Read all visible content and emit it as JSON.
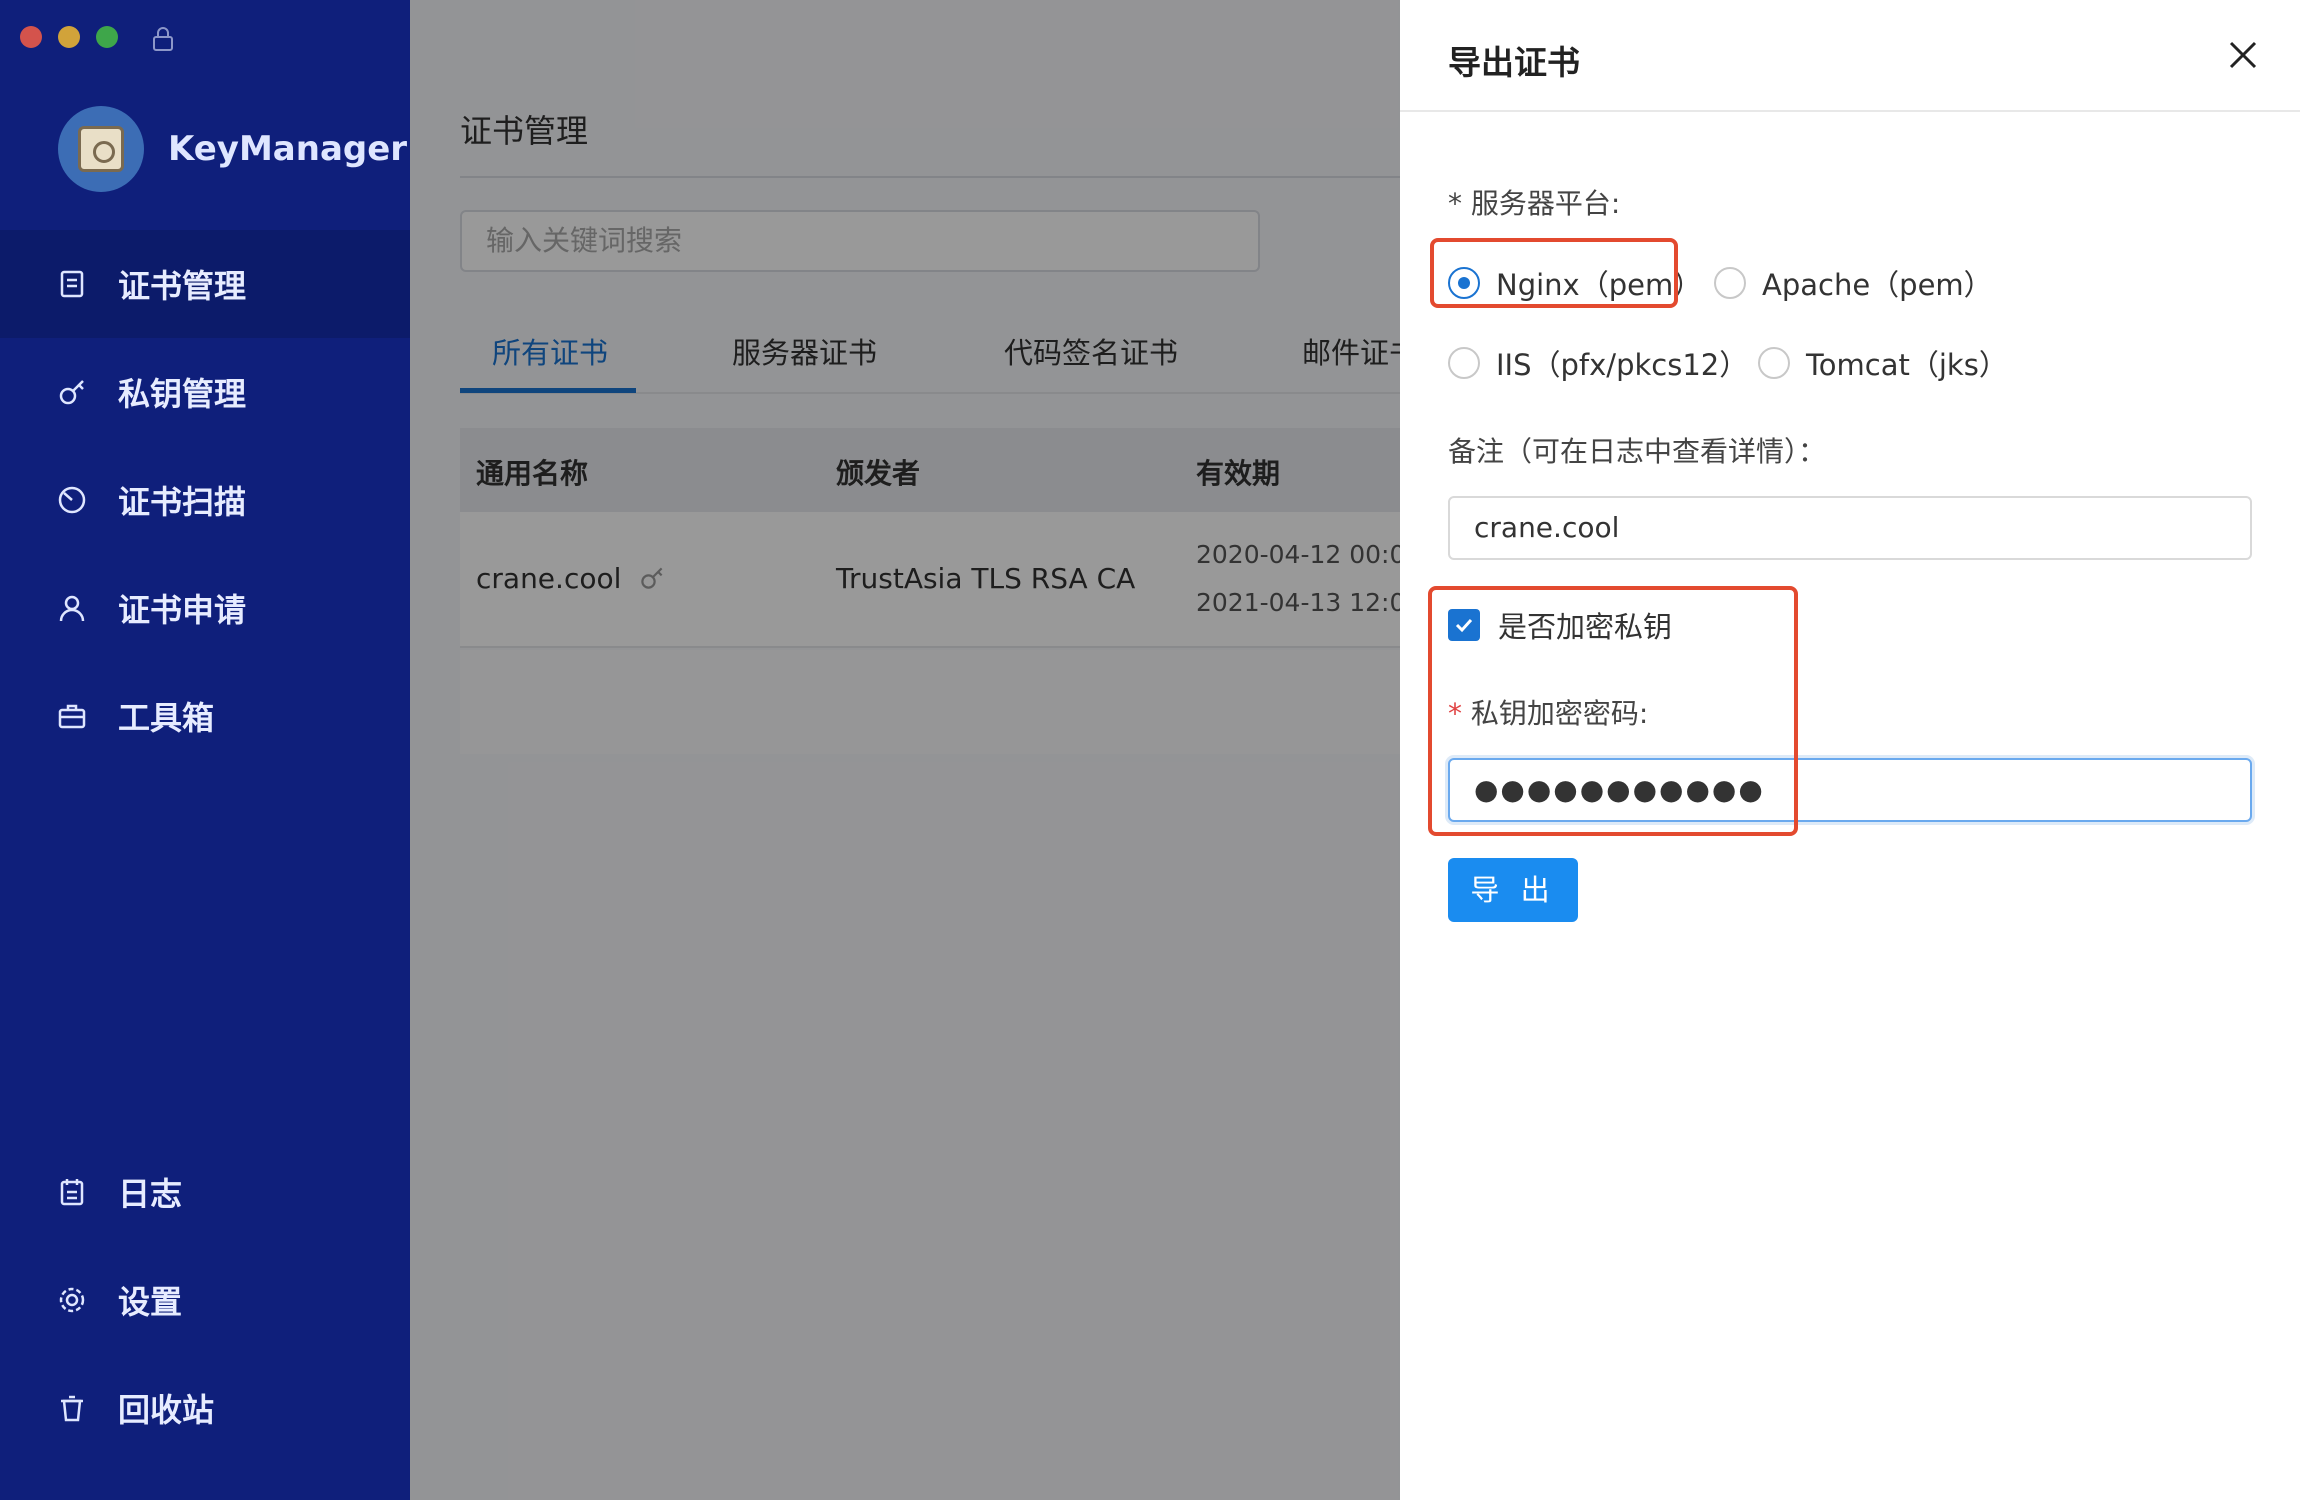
{
  "app": {
    "name": "KeyManager"
  },
  "sidebar": {
    "items": [
      {
        "label": "证书管理",
        "icon": "certificate-icon",
        "active": true
      },
      {
        "label": "私钥管理",
        "icon": "key-icon"
      },
      {
        "label": "证书扫描",
        "icon": "scan-icon"
      },
      {
        "label": "证书申请",
        "icon": "user-icon"
      },
      {
        "label": "工具箱",
        "icon": "toolbox-icon"
      }
    ],
    "bottom_items": [
      {
        "label": "日志",
        "icon": "log-icon"
      },
      {
        "label": "设置",
        "icon": "gear-icon"
      },
      {
        "label": "回收站",
        "icon": "trash-icon"
      }
    ]
  },
  "main": {
    "title": "证书管理",
    "search_placeholder": "输入关键词搜索",
    "tabs": [
      {
        "label": "所有证书",
        "active": true
      },
      {
        "label": "服务器证书"
      },
      {
        "label": "代码签名证书"
      },
      {
        "label": "邮件证书"
      }
    ],
    "table": {
      "headers": [
        "通用名称",
        "颁发者",
        "有效期"
      ],
      "rows": [
        {
          "name": "crane.cool",
          "issuer": "TrustAsia TLS RSA CA",
          "valid_from": "2020-04-12 00:0",
          "valid_to": "2021-04-13 12:0"
        }
      ]
    }
  },
  "drawer": {
    "title": "导出证书",
    "platform_label": "* 服务器平台:",
    "platforms": [
      {
        "label": "Nginx（pem）",
        "checked": true
      },
      {
        "label": "Apache（pem）"
      },
      {
        "label": "IIS（pfx/pkcs12）"
      },
      {
        "label": "Tomcat（jks）"
      }
    ],
    "note_label": "备注（可在日志中查看详情）：",
    "note_value": "crane.cool",
    "encrypt_label": "是否加密私钥",
    "encrypt_checked": true,
    "password_label_star": "*",
    "password_label": "私钥加密密码:",
    "password_value": "●●●●●●●●●●●",
    "export_button": "导 出"
  },
  "colors": {
    "sidebar_bg": "#0f1f7b",
    "primary": "#1a8cf0",
    "highlight": "#e34a2f"
  }
}
